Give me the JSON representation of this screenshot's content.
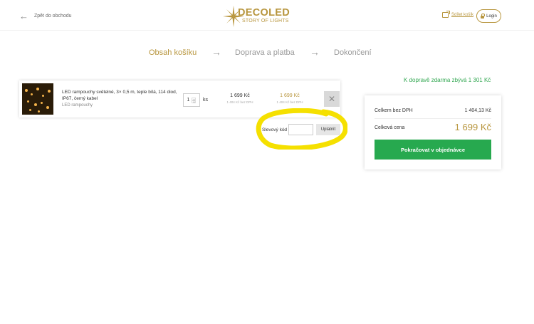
{
  "header": {
    "back_label": "Zpět do obchodu",
    "logo_title": "DECOLED",
    "logo_subtitle": "STORY OF LIGHTS",
    "share_label": "Sdílet košík",
    "login_label": "Login",
    "accent_color": "#b8963e"
  },
  "steps": [
    {
      "label": "Obsah košíku",
      "active": true
    },
    {
      "label": "Doprava a platba",
      "active": false
    },
    {
      "label": "Dokončení",
      "active": false
    }
  ],
  "free_shipping_text": "K dopravě zdarma zbývá 1 301 Kč",
  "cart_items": [
    {
      "name": "LED rampouchy světelné, 3× 0,5 m, teple bílá, 114 diod, IP67, černý kabel",
      "category": "LED rampouchy",
      "quantity": "1",
      "unit": "ks",
      "unit_price": "1 699 Kč",
      "unit_price_ex_vat": "1 404 Kč bez DPH",
      "total_price": "1 699 Kč",
      "total_price_ex_vat": "1 404 Kč bez DPH",
      "remove_icon": "close-icon"
    }
  ],
  "discount": {
    "label": "Slevový kód",
    "value": "",
    "apply_label": "Uplatnit",
    "highlight_color": "#f5e000"
  },
  "summary": {
    "subtotal_label": "Celkem bez DPH",
    "subtotal_value": "1 404,13 Kč",
    "total_label": "Celková cena",
    "total_value": "1 699 Kč",
    "checkout_label": "Pokračovat v objednávce",
    "checkout_color": "#27a94f"
  }
}
